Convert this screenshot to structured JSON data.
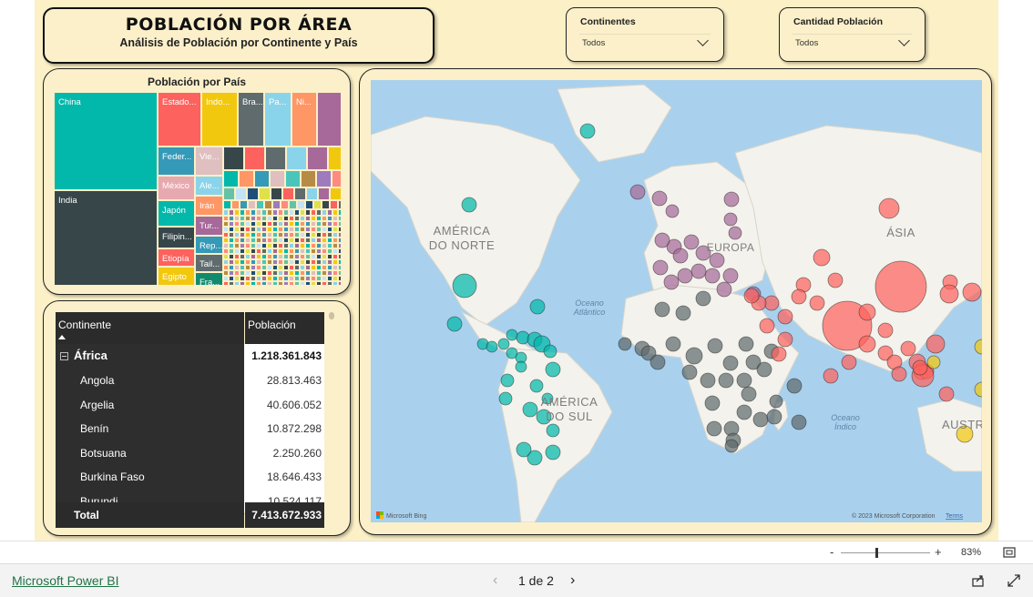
{
  "header": {
    "title": "POBLACIÓN POR ÁREA",
    "subtitle": "Análisis de Población por Continente y País"
  },
  "slicers": [
    {
      "label": "Continentes",
      "value": "Todos"
    },
    {
      "label": "Cantidad Población",
      "value": "Todos"
    }
  ],
  "treemap": {
    "title": "Población por País",
    "cells": [
      {
        "label": "China",
        "color": "#01b8aa"
      },
      {
        "label": "India",
        "color": "#374649"
      },
      {
        "label": "Estado...",
        "color": "#fd625e"
      },
      {
        "label": "Indo...",
        "color": "#f2c80f"
      },
      {
        "label": "Bra...",
        "color": "#5f6b6d"
      },
      {
        "label": "Pa...",
        "color": "#8ad4eb"
      },
      {
        "label": "Ni...",
        "color": "#fe9666"
      },
      {
        "label": "",
        "color": "#a66999"
      },
      {
        "label": "Feder...",
        "color": "#3599b8"
      },
      {
        "label": "Vie...",
        "color": "#dfbfbf"
      },
      {
        "label": "México",
        "color": "#e7a9b0"
      },
      {
        "label": "Ale...",
        "color": "#8ad4eb"
      },
      {
        "label": "Japón",
        "color": "#01b8aa"
      },
      {
        "label": "Irán",
        "color": "#fe9666"
      },
      {
        "label": "Filipin...",
        "color": "#374649"
      },
      {
        "label": "Tur...",
        "color": "#a66999"
      },
      {
        "label": "Etiopía",
        "color": "#fd625e"
      },
      {
        "label": "Rep...",
        "color": "#3599b8"
      },
      {
        "label": "Egipto",
        "color": "#f2c80f"
      },
      {
        "label": "Tail...",
        "color": "#5f6b6d"
      },
      {
        "label": "Fra...",
        "color": "#118b6e"
      }
    ]
  },
  "table": {
    "columns": [
      "Continente",
      "Población"
    ],
    "group": {
      "name": "África",
      "value": "1.218.361.843"
    },
    "rows": [
      {
        "name": "Angola",
        "value": "28.813.463"
      },
      {
        "name": "Argelia",
        "value": "40.606.052"
      },
      {
        "name": "Benín",
        "value": "10.872.298"
      },
      {
        "name": "Botsuana",
        "value": "2.250.260"
      },
      {
        "name": "Burkina Faso",
        "value": "18.646.433"
      },
      {
        "name": "Burundi",
        "value": "10.524.117"
      }
    ],
    "total_label": "Total",
    "total_value": "7.413.672.933"
  },
  "map": {
    "labels": {
      "na": "AMÉRICA DO NORTE",
      "sa": "AMÉRICA DO SUL",
      "eu": "EUROPA",
      "asia": "ÁSIA",
      "aus": "AUSTR",
      "atl": "Oceano Atlântico",
      "ind": "Oceano Índico"
    },
    "attribution": "© 2023 Microsoft Corporation",
    "terms": "Terms",
    "provider": "Microsoft Bing",
    "continent_colors": {
      "america": "#01b8aa",
      "europe": "#a66999",
      "africa": "#5f6b6d",
      "asia": "#fd625e",
      "oceania": "#f2c80f"
    }
  },
  "zoom": {
    "level": "83%",
    "minus": "-",
    "plus": "+"
  },
  "footer": {
    "brand": "Microsoft Power BI",
    "pages": "1 de 2"
  }
}
